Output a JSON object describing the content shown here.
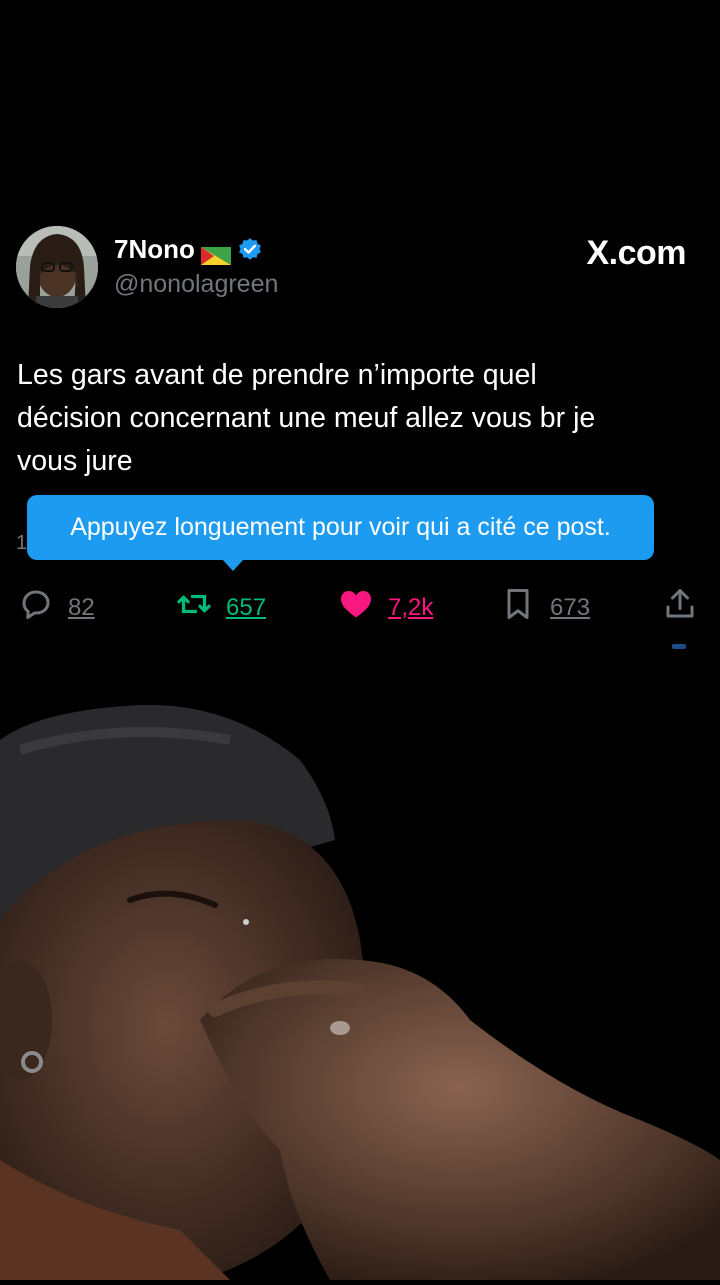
{
  "profile": {
    "display_name": "7Nono",
    "handle": "@nonolagreen",
    "flag_icon": "french-guiana-flag-icon",
    "verified_icon": "verified-badge-icon",
    "verified_color": "#1d9bf0"
  },
  "site_label": "X.com",
  "post": {
    "text": "Les gars avant de prendre n’importe quel\ndécision concernant une meuf allez vous br  je\nvous jure",
    "hidden_stub": "1"
  },
  "tooltip": {
    "text": "Appuyez longuement pour voir qui a cité ce post.",
    "color": "#1d9bf0"
  },
  "actions": {
    "replies": "82",
    "reposts": "657",
    "likes": "7,2k",
    "bookmarks": "673",
    "reply_color": "#71767b",
    "repost_color": "#00ba7c",
    "like_color": "#f91880"
  }
}
